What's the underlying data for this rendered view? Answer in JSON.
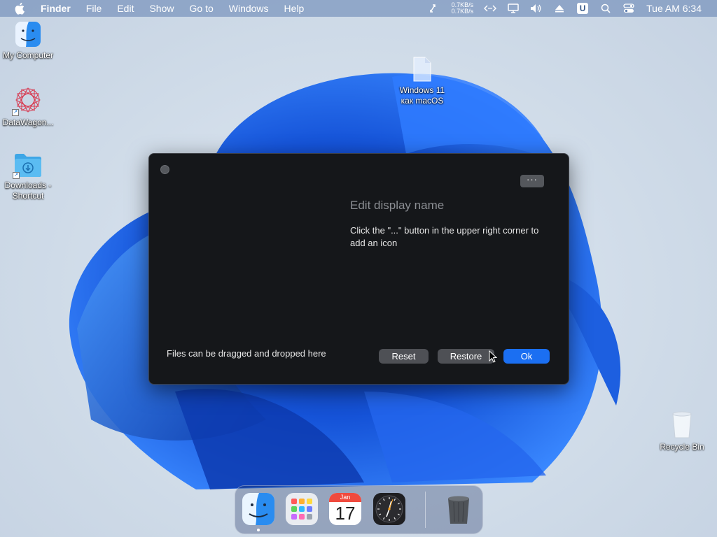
{
  "menubar": {
    "app_name": "Finder",
    "menus": [
      "File",
      "Edit",
      "Show",
      "Go to",
      "Windows",
      "Help"
    ],
    "net_up": "0.7KB/s",
    "net_down": "0.7KB/s",
    "u_badge": "U",
    "clock": "Tue AM 6:34",
    "icons": [
      "apple-icon",
      "arrows-icon",
      "code-icon",
      "display-icon",
      "volume-icon",
      "eject-icon",
      "search-icon",
      "control-center-icon"
    ]
  },
  "desktop": {
    "icons": [
      {
        "label": "My Computer",
        "icon": "finder-face-icon"
      },
      {
        "label": "DataWagon...",
        "icon": "datawagon-icon"
      },
      {
        "label_line1": "Downloads -",
        "label_line2": "Shortcut",
        "icon": "folder-download-icon"
      },
      {
        "label_line1": "Windows 11",
        "label_line2": "как macOS",
        "icon": "file-icon"
      },
      {
        "label": "Recycle Bin",
        "icon": "recycle-bin-icon"
      }
    ]
  },
  "dialog": {
    "more_label": "···",
    "title": "Edit display name",
    "description": "Click the \"...\" button in the upper right corner to add an icon",
    "drop_hint": "Files can be dragged and dropped here",
    "buttons": {
      "reset": "Reset",
      "restore": "Restore",
      "ok": "Ok"
    }
  },
  "dock": {
    "apps": [
      "finder-icon",
      "launchpad-icon",
      "calendar-icon",
      "clock-icon",
      "trash-icon"
    ],
    "calendar_month": "Jan",
    "calendar_day": "17"
  },
  "colors": {
    "accent": "#1b6ff2",
    "dialog_bg": "#15171a",
    "menubar": "#6080b0"
  }
}
